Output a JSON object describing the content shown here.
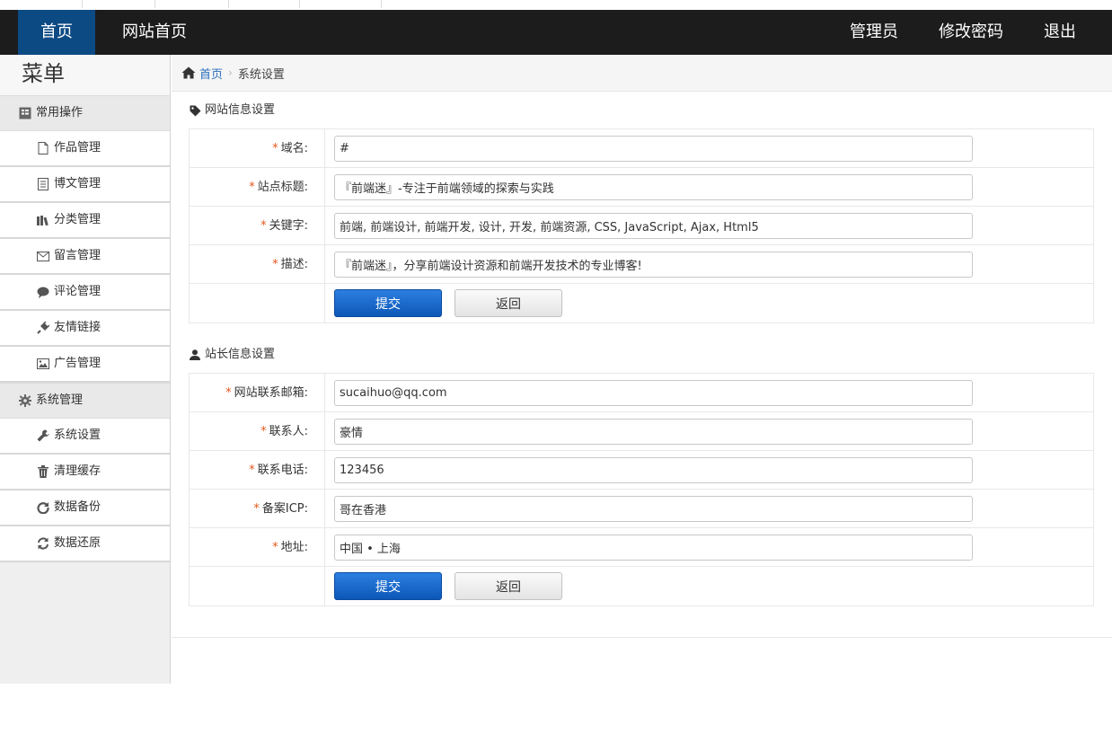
{
  "header": {
    "nav_home": "首页",
    "nav_site": "网站首页",
    "nav_admin": "管理员",
    "nav_password": "修改密码",
    "nav_logout": "退出"
  },
  "sidebar": {
    "title": "菜单",
    "groups": [
      {
        "label": "常用操作",
        "icon": "list-box-icon",
        "items": [
          {
            "label": "作品管理",
            "icon": "file-icon"
          },
          {
            "label": "博文管理",
            "icon": "document-icon"
          },
          {
            "label": "分类管理",
            "icon": "books-icon"
          },
          {
            "label": "留言管理",
            "icon": "envelope-icon"
          },
          {
            "label": "评论管理",
            "icon": "comment-icon"
          },
          {
            "label": "友情链接",
            "icon": "plug-icon"
          },
          {
            "label": "广告管理",
            "icon": "picture-icon"
          }
        ]
      },
      {
        "label": "系统管理",
        "icon": "gear-icon",
        "items": [
          {
            "label": "系统设置",
            "icon": "wrench-icon"
          },
          {
            "label": "清理缓存",
            "icon": "trash-icon"
          },
          {
            "label": "数据备份",
            "icon": "redo-icon"
          },
          {
            "label": "数据还原",
            "icon": "refresh-icon"
          }
        ]
      }
    ]
  },
  "breadcrumb": {
    "home": "首页",
    "current": "系统设置"
  },
  "site_info": {
    "title": "网站信息设置",
    "fields": [
      {
        "label": "域名:",
        "value": "#"
      },
      {
        "label": "站点标题:",
        "value": "『前端迷』-专注于前端领域的探索与实践"
      },
      {
        "label": "关键字:",
        "value": "前端, 前端设计, 前端开发, 设计, 开发, 前端资源, CSS, JavaScript, Ajax, Html5"
      },
      {
        "label": "描述:",
        "value": "『前端迷』，分享前端设计资源和前端开发技术的专业博客!"
      }
    ],
    "submit": "提交",
    "back": "返回"
  },
  "owner_info": {
    "title": "站长信息设置",
    "fields": [
      {
        "label": "网站联系邮箱:",
        "value": "sucaihuo@qq.com"
      },
      {
        "label": "联系人:",
        "value": "豪情"
      },
      {
        "label": "联系电话:",
        "value": "123456"
      },
      {
        "label": "备案ICP:",
        "value": "哥在香港"
      },
      {
        "label": "地址:",
        "value": "中国 • 上海"
      }
    ],
    "submit": "提交",
    "back": "返回"
  },
  "required_mark": "*",
  "colors": {
    "header_bg": "#1c1c1c",
    "active_nav": "#0c4a84",
    "link": "#2a6ebb",
    "required": "#e4571c",
    "submit_button": "#0c57b8"
  }
}
